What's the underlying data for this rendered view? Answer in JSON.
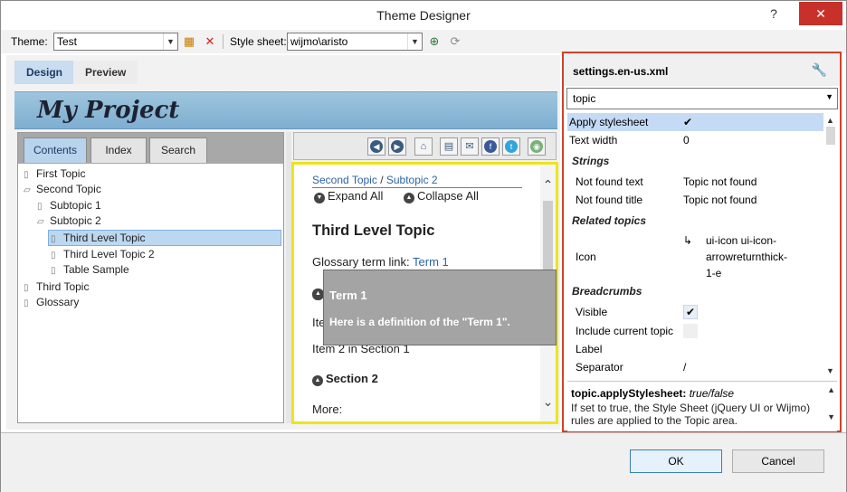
{
  "window": {
    "title": "Theme Designer",
    "help": "?",
    "close": "✕"
  },
  "toolbar": {
    "theme_label": "Theme:",
    "theme_value": "Test",
    "stylesheet_label": "Style sheet:",
    "stylesheet_value": "wijmo\\aristo"
  },
  "mode_tabs": [
    {
      "label": "Design"
    },
    {
      "label": "Preview"
    }
  ],
  "project": {
    "title": "My Project"
  },
  "nav_tabs": [
    {
      "label": "Contents"
    },
    {
      "label": "Index"
    },
    {
      "label": "Search"
    }
  ],
  "tree": [
    {
      "label": "First Topic"
    },
    {
      "label": "Second Topic"
    },
    {
      "label": "Subtopic 1"
    },
    {
      "label": "Subtopic 2"
    },
    {
      "label": "Third Level Topic"
    },
    {
      "label": "Third Level Topic 2"
    },
    {
      "label": "Table Sample"
    },
    {
      "label": "Third Topic"
    },
    {
      "label": "Glossary"
    }
  ],
  "topic": {
    "crumb_1": "Second Topic",
    "crumb_sep": "/",
    "crumb_2": "Subtopic 2",
    "expand_all": "Expand All",
    "collapse_all": "Collapse All",
    "heading": "Third Level Topic",
    "glossary_text": "Glossary term link:",
    "glossary_link": "Term 1",
    "item1_partial": "Ite",
    "item2": "Item 2 in Section 1",
    "section2": "Section 2",
    "more": "More:"
  },
  "tooltip": {
    "term": "Term 1",
    "definition": "Here is a definition of the \"Term 1\"."
  },
  "settings": {
    "filename": "settings.en-us.xml",
    "combo_value": "topic",
    "rows": {
      "apply_stylesheet": {
        "key": "Apply stylesheet",
        "value": "✔"
      },
      "text_width": {
        "key": "Text width",
        "value": "0"
      }
    },
    "sections": {
      "strings": "Strings",
      "related": "Related topics",
      "breadcrumbs": "Breadcrumbs"
    },
    "strings": {
      "not_found_text": {
        "key": "Not found text",
        "value": "Topic not found"
      },
      "not_found_title": {
        "key": "Not found title",
        "value": "Topic not found"
      }
    },
    "related": {
      "icon": {
        "key": "Icon",
        "glyph": "↳",
        "value_1": "ui-icon ui-icon-",
        "value_2": "arrowreturnthick-",
        "value_3": "1-e"
      }
    },
    "breadcrumbs": {
      "visible": {
        "key": "Visible",
        "value": "✔"
      },
      "include_current": {
        "key": "Include current topic"
      },
      "label": {
        "key": "Label"
      },
      "separator": {
        "key": "Separator",
        "value": "/"
      }
    },
    "description": {
      "name": "topic.applyStylesheet:",
      "type": "true/false",
      "text": "If set to true, the Style Sheet (jQuery UI or Wijmo) rules are applied to the Topic area."
    }
  },
  "footer": {
    "ok": "OK",
    "cancel": "Cancel"
  }
}
